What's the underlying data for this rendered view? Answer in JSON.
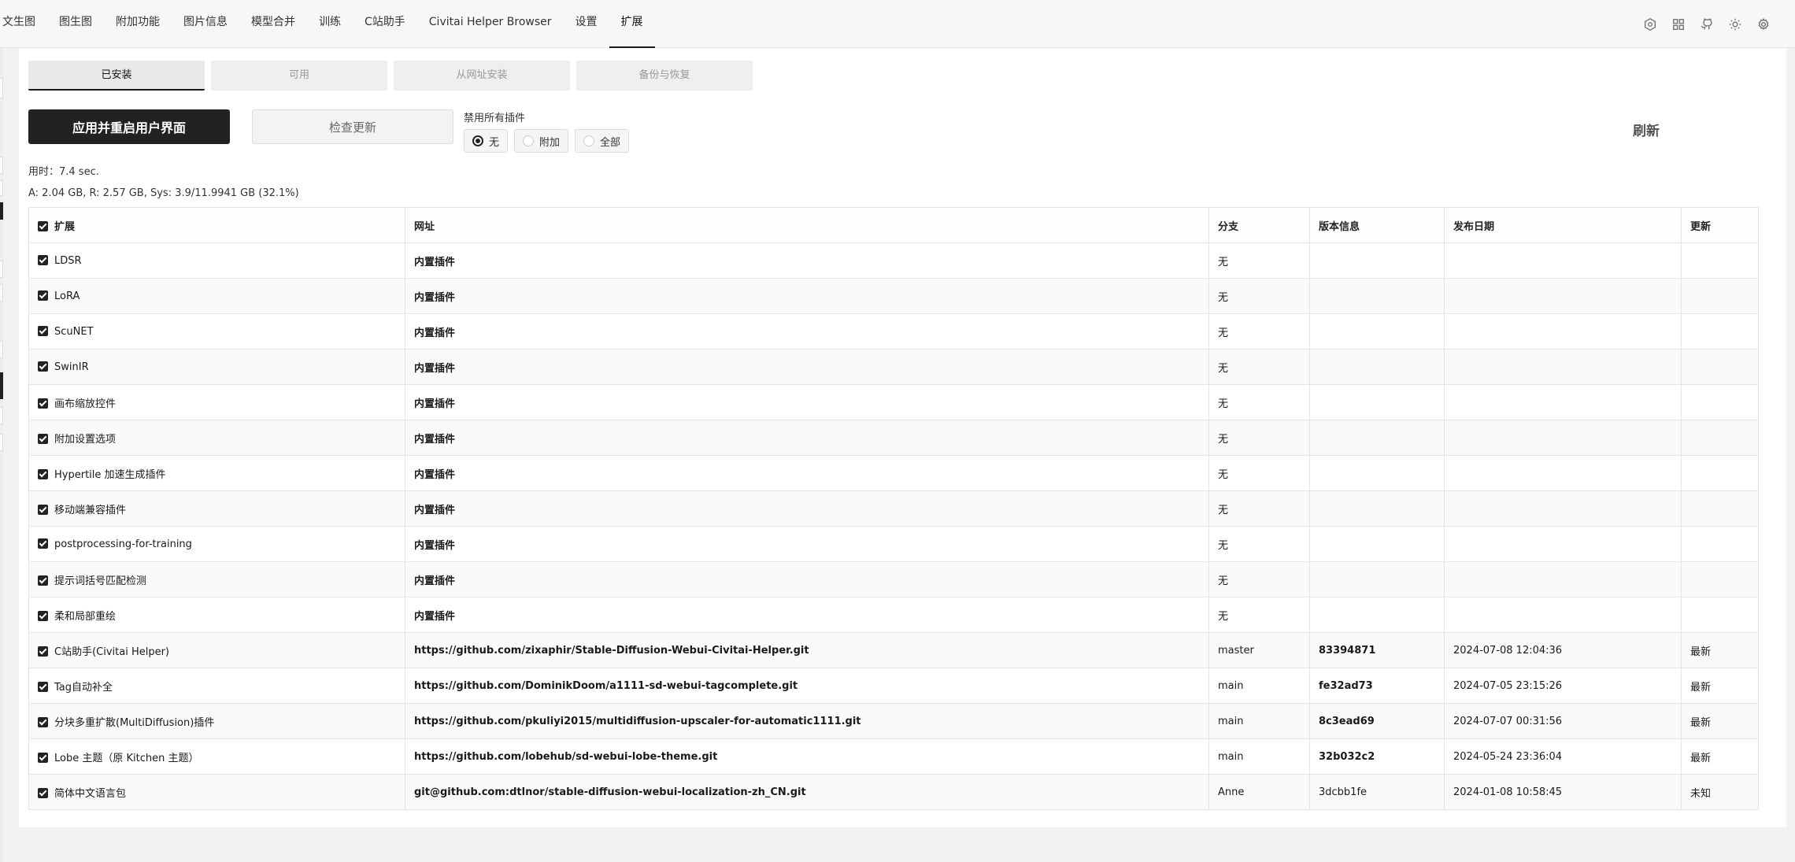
{
  "nav": {
    "tabs": [
      {
        "label": "文生图",
        "active": false
      },
      {
        "label": "图生图",
        "active": false
      },
      {
        "label": "附加功能",
        "active": false
      },
      {
        "label": "图片信息",
        "active": false
      },
      {
        "label": "模型合并",
        "active": false
      },
      {
        "label": "训练",
        "active": false
      },
      {
        "label": "C站助手",
        "active": false
      },
      {
        "label": "Civitai Helper Browser",
        "active": false
      },
      {
        "label": "设置",
        "active": false
      },
      {
        "label": "扩展",
        "active": true
      }
    ],
    "icons": [
      "settings-hex-icon",
      "grid-icon",
      "github-icon",
      "sun-icon",
      "gear-icon"
    ]
  },
  "subtabs": [
    {
      "label": "已安装",
      "active": true
    },
    {
      "label": "可用",
      "active": false
    },
    {
      "label": "从网址安装",
      "active": false
    },
    {
      "label": "备份与恢复",
      "active": false
    }
  ],
  "actions": {
    "apply_label": "应用并重启用户界面",
    "check_label": "检查更新",
    "refresh_label": "刷新"
  },
  "disable": {
    "label": "禁用所有插件",
    "options": [
      {
        "label": "无",
        "selected": true
      },
      {
        "label": "附加",
        "selected": false
      },
      {
        "label": "全部",
        "selected": false
      }
    ]
  },
  "stats": {
    "time": "用时：7.4 sec.",
    "memory": "A: 2.04 GB, R: 2.57 GB, Sys: 3.9/11.9941 GB (32.1%)"
  },
  "table": {
    "headers": [
      "扩展",
      "网址",
      "分支",
      "版本信息",
      "发布日期",
      "更新"
    ],
    "rows": [
      {
        "name": "LDSR",
        "url": "内置插件",
        "branch": "无",
        "version": "",
        "date": "",
        "update": ""
      },
      {
        "name": "LoRA",
        "url": "内置插件",
        "branch": "无",
        "version": "",
        "date": "",
        "update": ""
      },
      {
        "name": "ScuNET",
        "url": "内置插件",
        "branch": "无",
        "version": "",
        "date": "",
        "update": ""
      },
      {
        "name": "SwinIR",
        "url": "内置插件",
        "branch": "无",
        "version": "",
        "date": "",
        "update": ""
      },
      {
        "name": "画布缩放控件",
        "url": "内置插件",
        "branch": "无",
        "version": "",
        "date": "",
        "update": ""
      },
      {
        "name": "附加设置选项",
        "url": "内置插件",
        "branch": "无",
        "version": "",
        "date": "",
        "update": ""
      },
      {
        "name": "Hypertile 加速生成插件",
        "url": "内置插件",
        "branch": "无",
        "version": "",
        "date": "",
        "update": ""
      },
      {
        "name": "移动端兼容插件",
        "url": "内置插件",
        "branch": "无",
        "version": "",
        "date": "",
        "update": ""
      },
      {
        "name": "postprocessing-for-training",
        "url": "内置插件",
        "branch": "无",
        "version": "",
        "date": "",
        "update": ""
      },
      {
        "name": "提示词括号匹配检测",
        "url": "内置插件",
        "branch": "无",
        "version": "",
        "date": "",
        "update": ""
      },
      {
        "name": "柔和局部重绘",
        "url": "内置插件",
        "branch": "无",
        "version": "",
        "date": "",
        "update": ""
      },
      {
        "name": "C站助手(Civitai Helper)",
        "url": "https://github.com/zixaphir/Stable-Diffusion-Webui-Civitai-Helper.git",
        "branch": "master",
        "version": "83394871",
        "date": "2024-07-08 12:04:36",
        "update": "最新"
      },
      {
        "name": "Tag自动补全",
        "url": "https://github.com/DominikDoom/a1111-sd-webui-tagcomplete.git",
        "branch": "main",
        "version": "fe32ad73",
        "date": "2024-07-05 23:15:26",
        "update": "最新"
      },
      {
        "name": "分块多重扩散(MultiDiffusion)插件",
        "url": "https://github.com/pkuliyi2015/multidiffusion-upscaler-for-automatic1111.git",
        "branch": "main",
        "version": "8c3ead69",
        "date": "2024-07-07 00:31:56",
        "update": "最新"
      },
      {
        "name": "Lobe 主题（原 Kitchen 主题）",
        "url": "https://github.com/lobehub/sd-webui-lobe-theme.git",
        "branch": "main",
        "version": "32b032c2",
        "date": "2024-05-24 23:36:04",
        "update": "最新"
      },
      {
        "name": "简体中文语言包",
        "url": "git@github.com:dtlnor/stable-diffusion-webui-localization-zh_CN.git",
        "branch": "Anne",
        "version": "3dcbb1fe",
        "date": "2024-01-08 10:58:45",
        "update": "未知"
      }
    ]
  }
}
